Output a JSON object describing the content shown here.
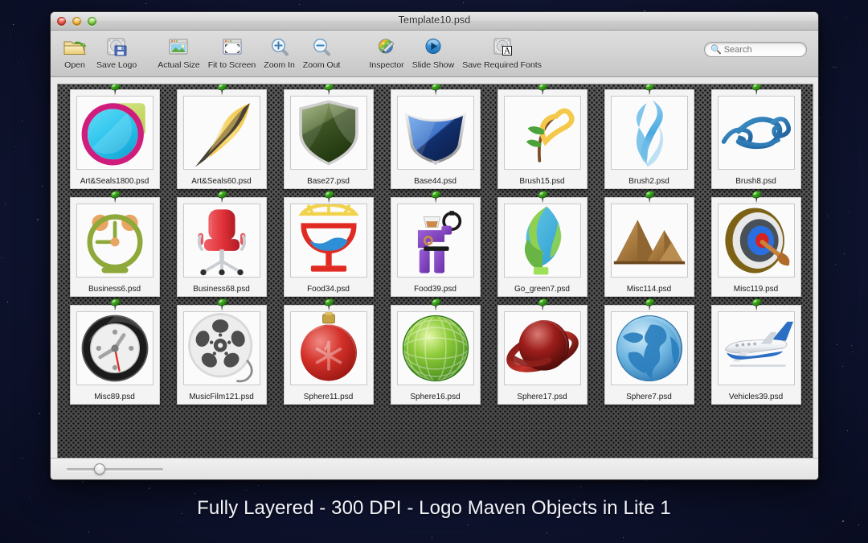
{
  "window": {
    "title": "Template10.psd",
    "traffic_lights": [
      "close-button",
      "minimize-button",
      "zoom-button"
    ]
  },
  "toolbar": {
    "items": [
      {
        "label": "Open",
        "icon": "open-folder-icon"
      },
      {
        "label": "Save Logo",
        "icon": "save-disk-icon"
      },
      {
        "label": "Actual Size",
        "icon": "actual-size-icon"
      },
      {
        "label": "Fit to Screen",
        "icon": "fit-to-screen-icon"
      },
      {
        "label": "Zoom In",
        "icon": "zoom-in-icon"
      },
      {
        "label": "Zoom Out",
        "icon": "zoom-out-icon"
      },
      {
        "label": "Inspector",
        "icon": "inspector-palette-icon"
      },
      {
        "label": "Slide Show",
        "icon": "slide-show-play-icon"
      },
      {
        "label": "Save Required Fonts",
        "icon": "save-fonts-icon"
      }
    ]
  },
  "search": {
    "placeholder": "Search",
    "value": "",
    "icon": "search-icon"
  },
  "browser": {
    "items": [
      {
        "name": "Art&Seals1800.psd",
        "art": "art-seals-1800"
      },
      {
        "name": "Art&Seals60.psd",
        "art": "art-seals-60"
      },
      {
        "name": "Base27.psd",
        "art": "base-27"
      },
      {
        "name": "Base44.psd",
        "art": "base-44"
      },
      {
        "name": "Brush15.psd",
        "art": "brush-15"
      },
      {
        "name": "Brush2.psd",
        "art": "brush-2"
      },
      {
        "name": "Brush8.psd",
        "art": "brush-8"
      },
      {
        "name": "Business6.psd",
        "art": "business-6"
      },
      {
        "name": "Business68.psd",
        "art": "business-68"
      },
      {
        "name": "Food34.psd",
        "art": "food-34"
      },
      {
        "name": "Food39.psd",
        "art": "food-39"
      },
      {
        "name": "Go_green7.psd",
        "art": "go-green-7"
      },
      {
        "name": "Misc114.psd",
        "art": "misc-114"
      },
      {
        "name": "Misc119.psd",
        "art": "misc-119"
      },
      {
        "name": "Misc89.psd",
        "art": "misc-89"
      },
      {
        "name": "MusicFilm121.psd",
        "art": "musicfilm-121"
      },
      {
        "name": "Sphere11.psd",
        "art": "sphere-11"
      },
      {
        "name": "Sphere16.psd",
        "art": "sphere-16"
      },
      {
        "name": "Sphere17.psd",
        "art": "sphere-17"
      },
      {
        "name": "Sphere7.psd",
        "art": "sphere-7"
      },
      {
        "name": "Vehicles39.psd",
        "art": "vehicles-39"
      }
    ]
  },
  "zoom_slider": {
    "value": 32,
    "min": 0,
    "max": 100
  },
  "caption": "Fully Layered - 300 DPI - Logo Maven Objects in Lite 1",
  "colors": {
    "desktop": "#0e1330",
    "window_chrome": "#d6d6d6",
    "content_bg": "#4c4c4c",
    "caption_text": "#f3f4fa",
    "pin_green": "#2f9e1e"
  }
}
